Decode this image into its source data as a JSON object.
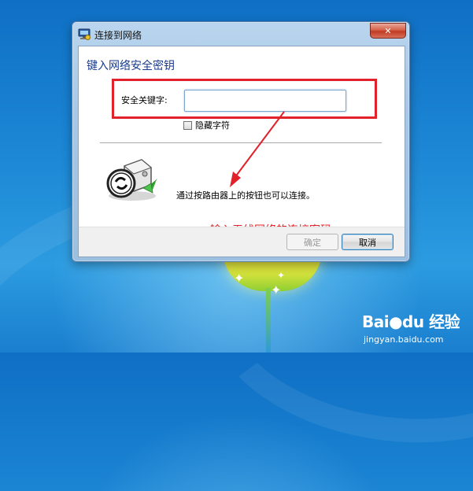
{
  "window": {
    "title": "连接到网络",
    "close_glyph": "✕"
  },
  "dialog": {
    "heading": "键入网络安全密钥",
    "key_label": "安全关键字:",
    "key_value": "",
    "hide_chars_label": "隐藏字符",
    "hide_chars_checked": false,
    "router_hint": "通过按路由器上的按钮也可以连接。"
  },
  "annotation": {
    "text": "输入无线网络的连接密码",
    "color": "#e2222a"
  },
  "buttons": {
    "ok_label": "确定",
    "ok_enabled": false,
    "cancel_label": "取消"
  },
  "watermark": {
    "logo_text": "Bai●du 经验",
    "url": "jingyan.baidu.com"
  },
  "colors": {
    "heading": "#1a3a8f",
    "highlight": "#e2222a",
    "desktop": "#1d88d6"
  }
}
